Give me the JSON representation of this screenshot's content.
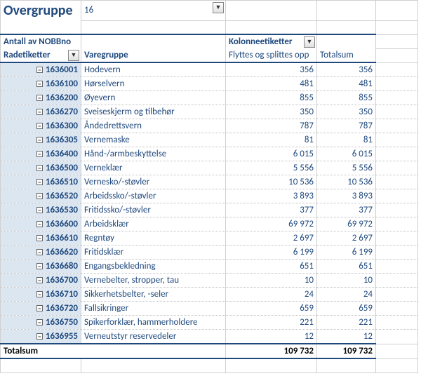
{
  "header": {
    "title_label": "Overgruppe",
    "title_value": "16"
  },
  "pivot": {
    "measure_label": "Antall av NOBBno",
    "row_label": "Radetiketter",
    "col_group_label": "Varegruppe",
    "column_header": "Kolonneetiketter",
    "col1_header": "Flyttes og splittes opp",
    "col2_header": "Totalsum",
    "rows": [
      {
        "code": "1636001",
        "name": "Hodevern",
        "v1": "356",
        "v2": "356"
      },
      {
        "code": "1636100",
        "name": "Hørselvern",
        "v1": "481",
        "v2": "481"
      },
      {
        "code": "1636200",
        "name": "Øyevern",
        "v1": "855",
        "v2": "855"
      },
      {
        "code": "1636270",
        "name": "Sveiseskjerm og tilbehør",
        "v1": "350",
        "v2": "350"
      },
      {
        "code": "1636300",
        "name": "Åndedrettsvern",
        "v1": "787",
        "v2": "787"
      },
      {
        "code": "1636305",
        "name": "Vernemaske",
        "v1": "81",
        "v2": "81"
      },
      {
        "code": "1636400",
        "name": "Hånd-/armbeskyttelse",
        "v1": "6 015",
        "v2": "6 015"
      },
      {
        "code": "1636500",
        "name": "Verneklær",
        "v1": "5 556",
        "v2": "5 556"
      },
      {
        "code": "1636510",
        "name": "Vernesko/-støvler",
        "v1": "10 536",
        "v2": "10 536"
      },
      {
        "code": "1636520",
        "name": "Arbeidssko/-støvler",
        "v1": "3 893",
        "v2": "3 893"
      },
      {
        "code": "1636530",
        "name": "Fritidssko/-støvler",
        "v1": "377",
        "v2": "377"
      },
      {
        "code": "1636600",
        "name": "Arbeidsklær",
        "v1": "69 972",
        "v2": "69 972"
      },
      {
        "code": "1636610",
        "name": "Regntøy",
        "v1": "2 697",
        "v2": "2 697"
      },
      {
        "code": "1636620",
        "name": "Fritidsklær",
        "v1": "6 199",
        "v2": "6 199"
      },
      {
        "code": "1636680",
        "name": "Engangsbekledning",
        "v1": "651",
        "v2": "651"
      },
      {
        "code": "1636700",
        "name": "Vernebelter, stropper, tau",
        "v1": "10",
        "v2": "10"
      },
      {
        "code": "1636710",
        "name": "Sikkerhetsbelter, -seler",
        "v1": "24",
        "v2": "24"
      },
      {
        "code": "1636720",
        "name": "Fallsikringer",
        "v1": "659",
        "v2": "659"
      },
      {
        "code": "1636750",
        "name": "Spikerforklær, hammerholdere",
        "v1": "221",
        "v2": "221"
      },
      {
        "code": "1636955",
        "name": "Verneutstyr reservedeler",
        "v1": "12",
        "v2": "12"
      }
    ],
    "grand_label": "Totalsum",
    "grand_v1": "109 732",
    "grand_v2": "109 732"
  },
  "icons": {
    "filter": "▼",
    "dropdown": "▼",
    "collapse": "−"
  }
}
